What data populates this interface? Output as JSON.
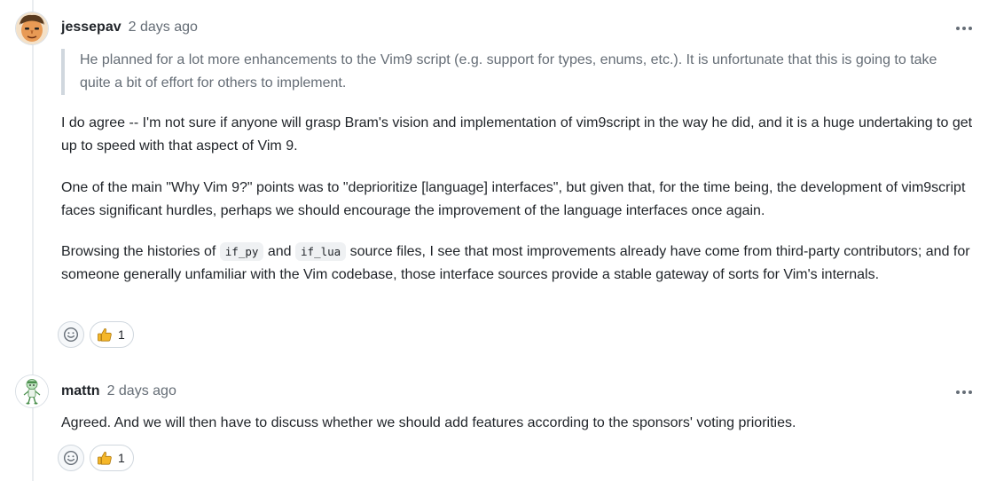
{
  "comments": [
    {
      "author": "jessepav",
      "time": "2 days ago",
      "quote": "He planned for a lot more enhancements to the Vim9 script (e.g. support for types, enums, etc.). It is unfortunate that this is going to take quite a bit of effort for others to implement.",
      "paragraph1": "I do agree -- I'm not sure if anyone will grasp Bram's vision and implementation of vim9script in the way he did, and it is a huge undertaking to get up to speed with that aspect of Vim 9.",
      "paragraph2": "One of the main \"Why Vim 9?\" points was to \"deprioritize [language] interfaces\", but given that, for the time being, the development of vim9script faces significant hurdles, perhaps we should encourage the improvement of the language interfaces once again.",
      "paragraph3_before": "Browsing the histories of",
      "code1": "if_py",
      "paragraph3_and": "and",
      "code2": "if_lua",
      "paragraph3_after": "source files, I see that most improvements already have come from third-party contributors; and for someone generally unfamiliar with the Vim codebase, those interface sources provide a stable gateway of sorts for Vim's internals.",
      "reaction_icon": "thumbs-up-icon",
      "reaction_count": "1"
    },
    {
      "author": "mattn",
      "time": "2 days ago",
      "text": "Agreed. And we will then have to discuss whether we should add features according to the sponsors' voting priorities.",
      "reaction_icon": "thumbs-up-icon",
      "reaction_count": "1"
    }
  ],
  "colors": {
    "text": "#1f2328",
    "muted": "#656d76",
    "border": "#d0d7de",
    "thread_line": "#eaedf0"
  }
}
